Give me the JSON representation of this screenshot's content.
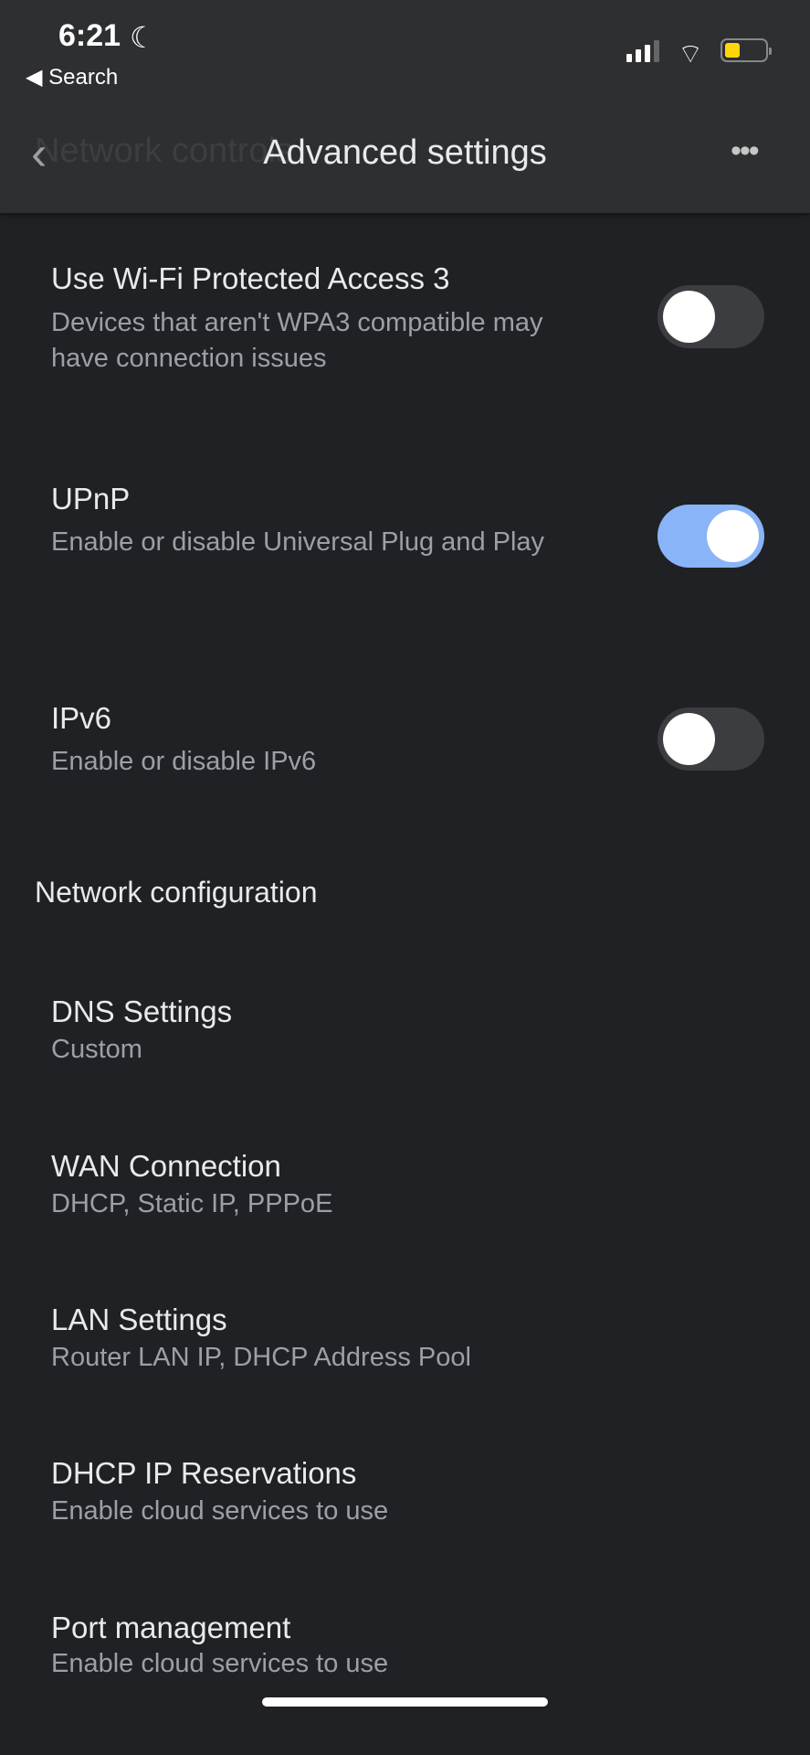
{
  "status_bar": {
    "time": "6:21",
    "back_app": "Search",
    "battery_color": "#ffd60a"
  },
  "header": {
    "back_label": "Network controls",
    "title": "Advanced settings",
    "more_icon": "more-horizontal-icon"
  },
  "toggles": [
    {
      "title": "Use Wi-Fi Protected Access 3",
      "subtitle": "Devices that aren't WPA3 compatible may have connection issues",
      "on": false
    },
    {
      "title": "UPnP",
      "subtitle": "Enable or disable Universal Plug and Play",
      "on": true
    },
    {
      "title": "IPv6",
      "subtitle": "Enable or disable IPv6",
      "on": false
    }
  ],
  "section_title": "Network configuration",
  "items": [
    {
      "title": "DNS Settings",
      "subtitle": "Custom"
    },
    {
      "title": "WAN Connection",
      "subtitle": "DHCP, Static IP, PPPoE"
    },
    {
      "title": "LAN Settings",
      "subtitle": "Router LAN IP, DHCP Address Pool"
    },
    {
      "title": "DHCP IP Reservations",
      "subtitle": "Enable cloud services to use"
    },
    {
      "title": "Port management",
      "subtitle": "Enable cloud services to use"
    }
  ],
  "colors": {
    "accent": "#8ab4f8",
    "background": "#202124",
    "header": "#2e2f31"
  }
}
